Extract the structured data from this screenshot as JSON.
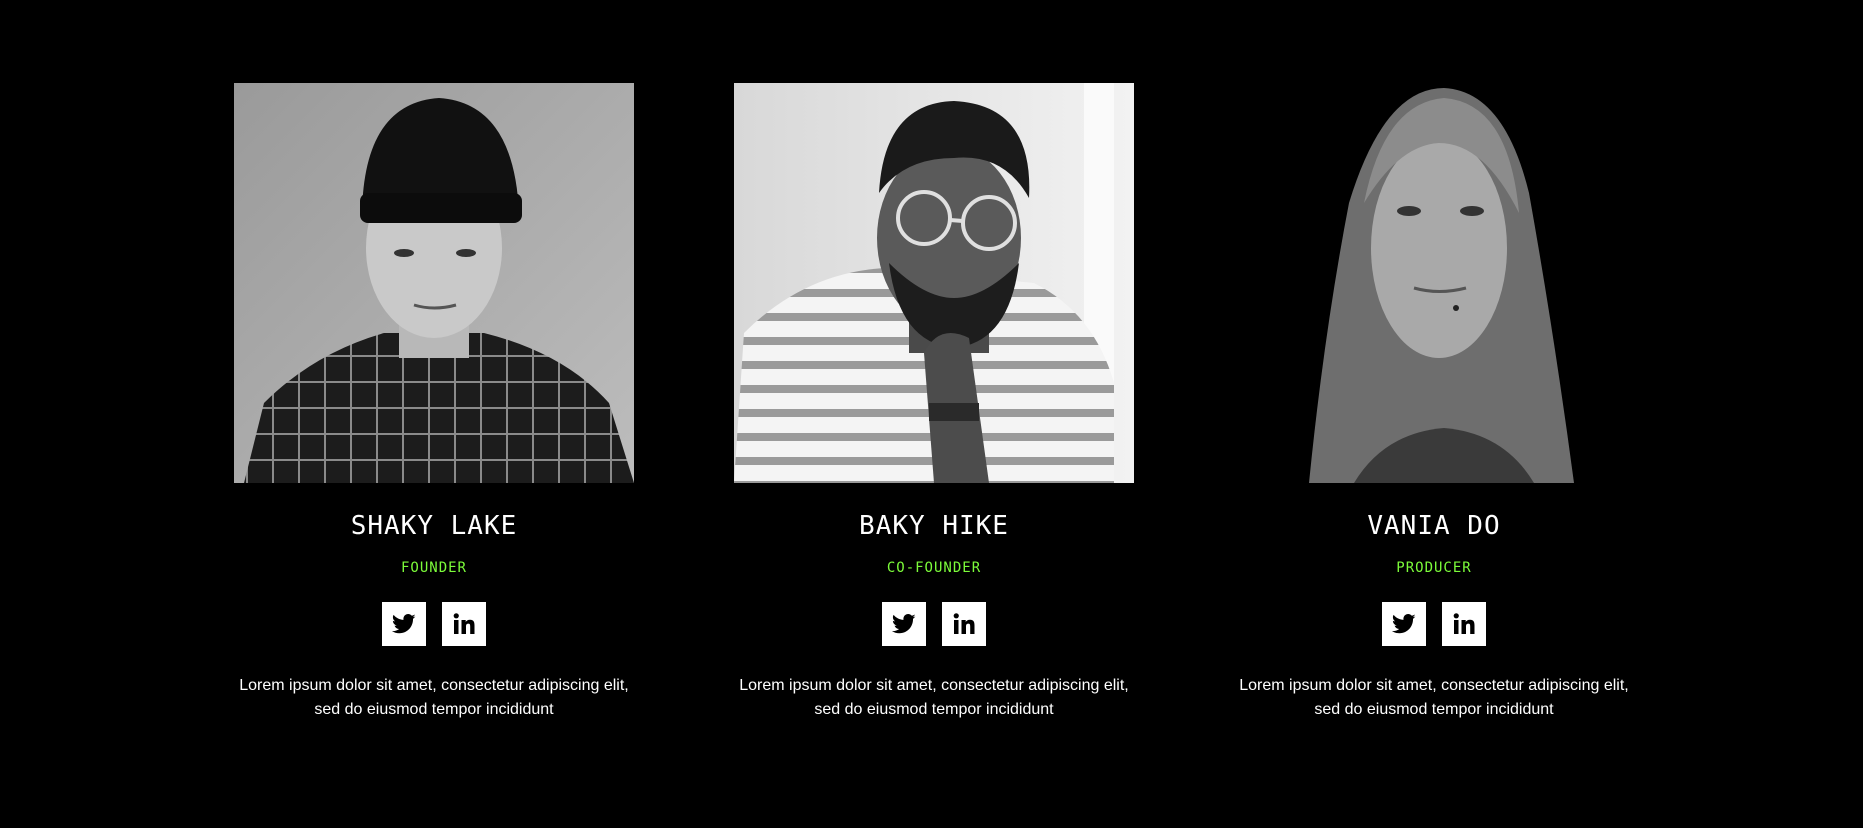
{
  "team": {
    "members": [
      {
        "name": "SHAKY LAKE",
        "role": "FOUNDER",
        "bio": "Lorem ipsum dolor sit amet, consectetur adipiscing elit, sed do eiusmod tempor incididunt",
        "socials": [
          "twitter-icon",
          "linkedin-icon"
        ]
      },
      {
        "name": "BAKY HIKE",
        "role": "CO-FOUNDER",
        "bio": "Lorem ipsum dolor sit amet, consectetur adipiscing elit, sed do eiusmod tempor incididunt",
        "socials": [
          "twitter-icon",
          "linkedin-icon"
        ]
      },
      {
        "name": "VANIA DO",
        "role": "PRODUCER",
        "bio": "Lorem ipsum dolor sit amet, consectetur adipiscing elit, sed do eiusmod tempor incididunt",
        "socials": [
          "twitter-icon",
          "linkedin-icon"
        ]
      }
    ]
  },
  "colors": {
    "background": "#000000",
    "accent": "#7CFC3A",
    "text": "#ffffff"
  }
}
